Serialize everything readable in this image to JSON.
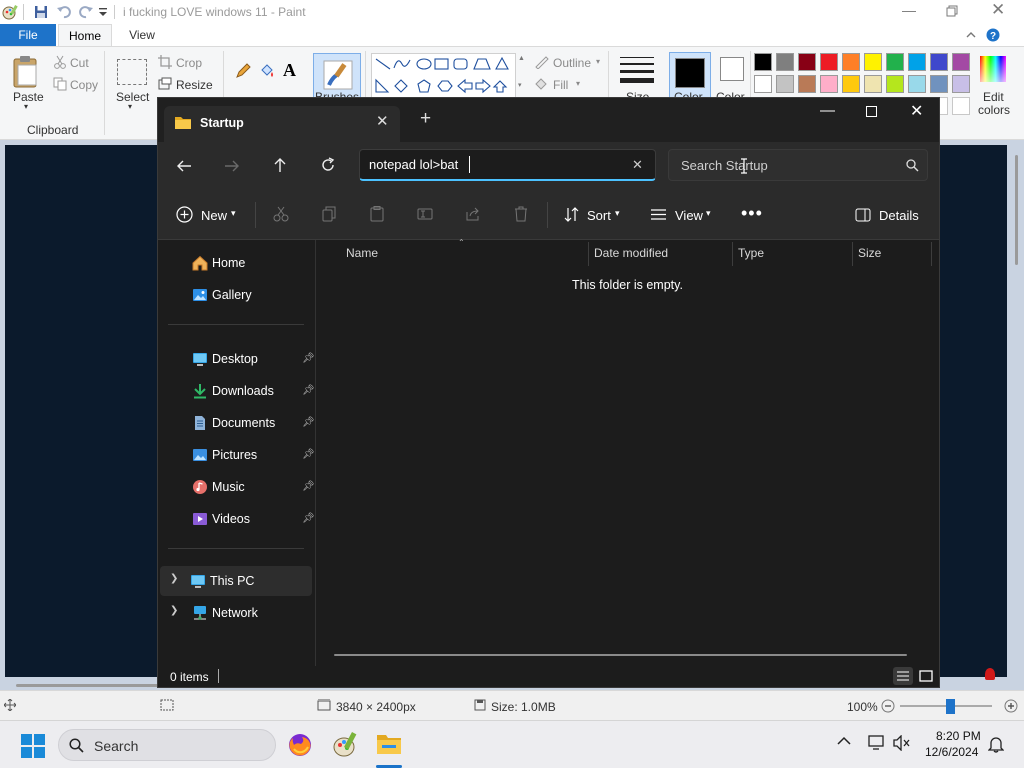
{
  "paint": {
    "title": "i fucking LOVE windows 11 - Paint",
    "tabs": {
      "file": "File",
      "home": "Home",
      "view": "View"
    },
    "clipboard": {
      "paste": "Paste",
      "cut": "Cut",
      "copy": "Copy",
      "group": "Clipboard"
    },
    "image": {
      "select": "Select",
      "crop": "Crop",
      "resize": "Resize",
      "brushes": "Brushes"
    },
    "shapes": {
      "outline": "Outline",
      "fill": "Fill"
    },
    "size_label": "Size",
    "color1_label": "Color",
    "color2_label": "Color",
    "edit_colors_line1": "Edit",
    "edit_colors_line2": "colors",
    "palette_row1": [
      "#000000",
      "#7f7f7f",
      "#880015",
      "#ed1c24",
      "#ff7f27",
      "#fff200",
      "#22b14c",
      "#00a2e8",
      "#3f48cc",
      "#a349a4"
    ],
    "palette_row2": [
      "#ffffff",
      "#c3c3c3",
      "#b97a57",
      "#ffaec9",
      "#ffc90e",
      "#efe4b0",
      "#b5e61d",
      "#99d9ea",
      "#7092be",
      "#c8bfe7"
    ],
    "status": {
      "dimensions": "3840 × 2400px",
      "size": "Size: 1.0MB",
      "zoom": "100%"
    }
  },
  "explorer": {
    "tab_title": "Startup",
    "address_value": "notepad lol>bat",
    "search_placeholder": "Search Startup",
    "cmd": {
      "new": "New",
      "sort": "Sort",
      "view": "View",
      "details": "Details"
    },
    "nav": {
      "home": "Home",
      "gallery": "Gallery",
      "desktop": "Desktop",
      "downloads": "Downloads",
      "documents": "Documents",
      "pictures": "Pictures",
      "music": "Music",
      "videos": "Videos",
      "this_pc": "This PC",
      "network": "Network"
    },
    "columns": {
      "name": "Name",
      "date": "Date modified",
      "type": "Type",
      "size": "Size"
    },
    "empty_message": "This folder is empty.",
    "status_items": "0 items"
  },
  "taskbar": {
    "search_label": "Search",
    "time": "8:20 PM",
    "date": "12/6/2024"
  }
}
